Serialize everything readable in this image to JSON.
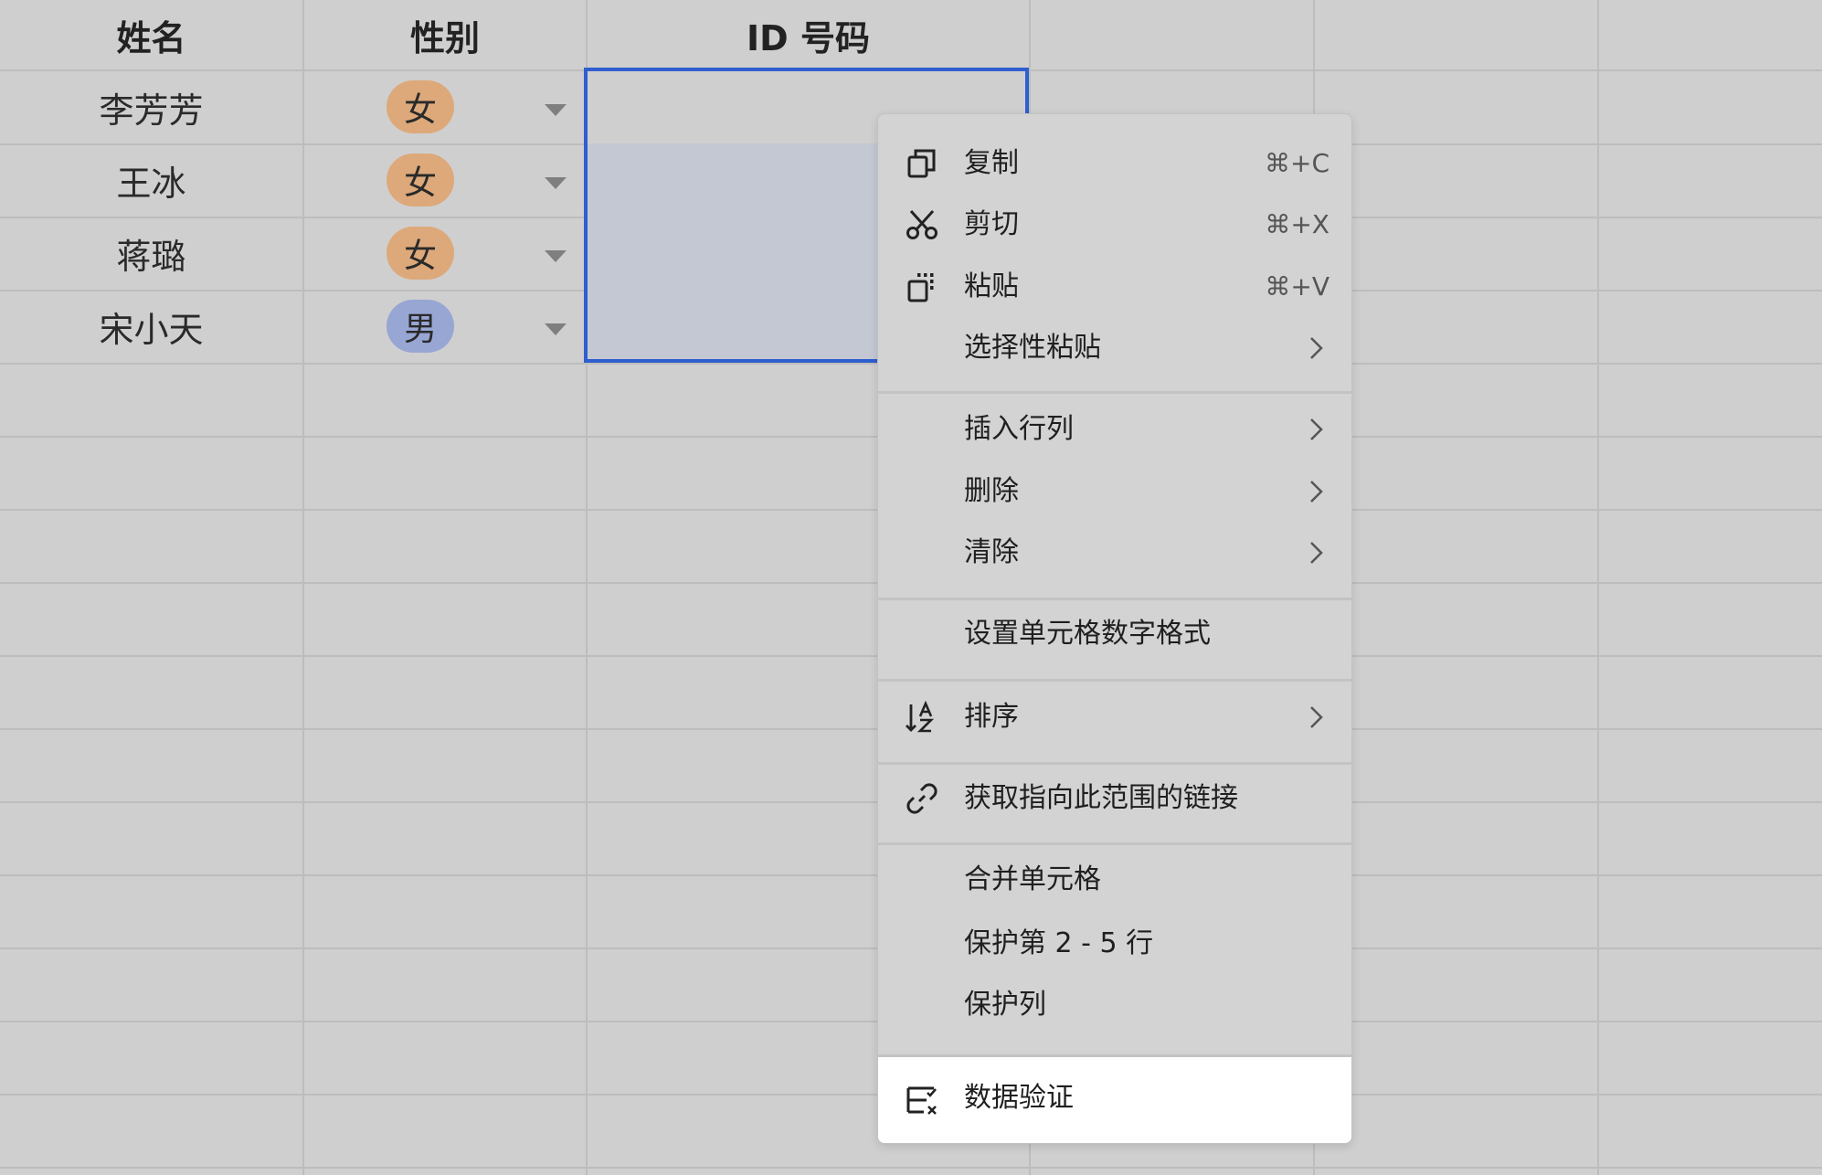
{
  "columns": {
    "name": "姓名",
    "gender": "性别",
    "id": "ID 号码"
  },
  "rows": [
    {
      "name": "李芳芳",
      "gender": "女"
    },
    {
      "name": "王冰",
      "gender": "女"
    },
    {
      "name": "蒋璐",
      "gender": "女"
    },
    {
      "name": "宋小天",
      "gender": "男"
    }
  ],
  "colors": {
    "female_tag": "#dda97a",
    "male_tag": "#98a6d4",
    "selection_border": "#2f5ecf",
    "highlight": "#ffffff"
  },
  "menu": {
    "copy": {
      "label": "复制",
      "shortcut": "⌘+C",
      "icon": "copy-icon"
    },
    "cut": {
      "label": "剪切",
      "shortcut": "⌘+X",
      "icon": "scissors-icon"
    },
    "paste": {
      "label": "粘贴",
      "shortcut": "⌘+V",
      "icon": "paste-icon"
    },
    "paste_special": {
      "label": "选择性粘贴"
    },
    "insert": {
      "label": "插入行列"
    },
    "delete": {
      "label": "删除"
    },
    "clear": {
      "label": "清除"
    },
    "number_format": {
      "label": "设置单元格数字格式"
    },
    "sort": {
      "label": "排序",
      "icon": "sort-icon"
    },
    "link": {
      "label": "获取指向此范围的链接",
      "icon": "link-icon"
    },
    "merge": {
      "label": "合并单元格"
    },
    "protect_rows": {
      "label": "保护第 2 - 5 行"
    },
    "protect_col": {
      "label": "保护列"
    },
    "validation": {
      "label": "数据验证",
      "icon": "data-validation-icon"
    }
  }
}
